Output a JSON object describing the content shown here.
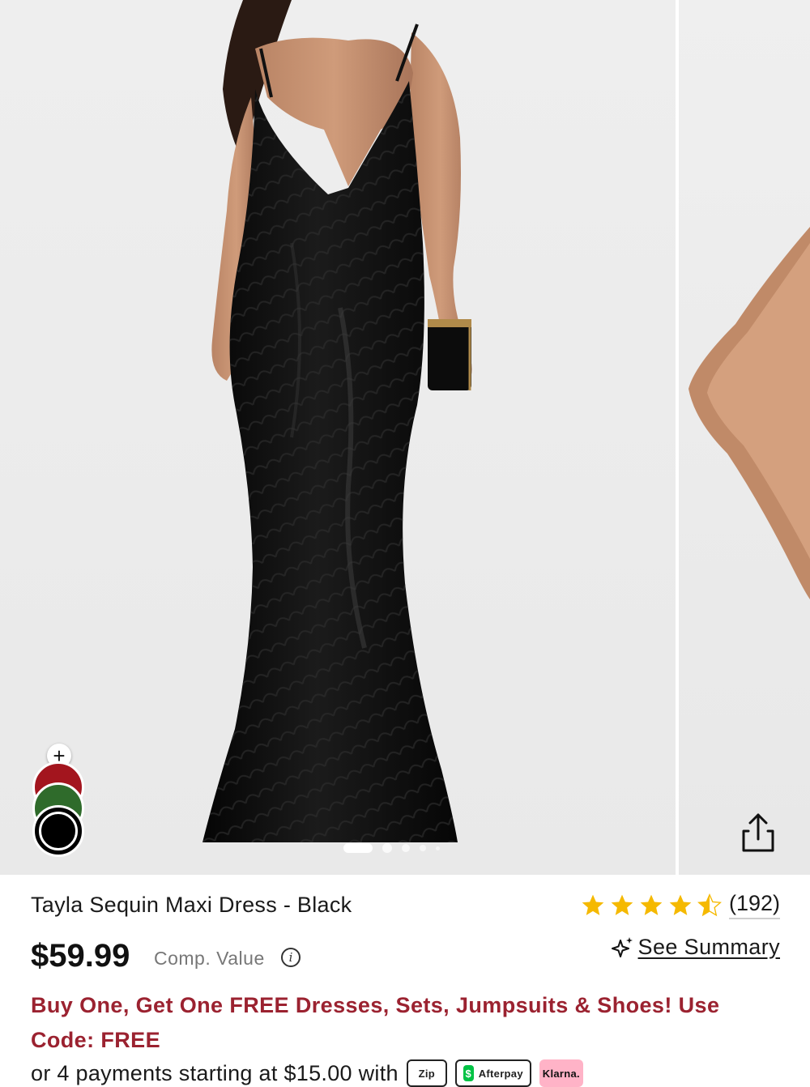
{
  "product": {
    "title": "Tayla Sequin Maxi Dress - Black",
    "price": "$59.99",
    "comp_value_label": "Comp. Value",
    "info_icon": "i",
    "rating": {
      "stars": 4.5,
      "review_count": "(192)"
    },
    "summary_link": "See Summary",
    "promo": "Buy One, Get One FREE Dresses, Sets, Jumpsuits & Shoes! Use Code: FREE",
    "payments_text": "or 4 payments starting at $15.00 with",
    "payment_providers": [
      "Zip",
      "Afterpay",
      "Klarna."
    ]
  },
  "carousel": {
    "total_slides": 5,
    "active_index": 0,
    "swatch_add_label": "+",
    "swatches": [
      {
        "name": "Red",
        "color": "#a3151e"
      },
      {
        "name": "Green",
        "color": "#2f6b2b"
      },
      {
        "name": "Black",
        "color": "#000000",
        "selected": true
      }
    ]
  },
  "colors": {
    "promo_red": "#9b2230",
    "star_gold": "#f5b900",
    "background_gray": "#ececec"
  }
}
